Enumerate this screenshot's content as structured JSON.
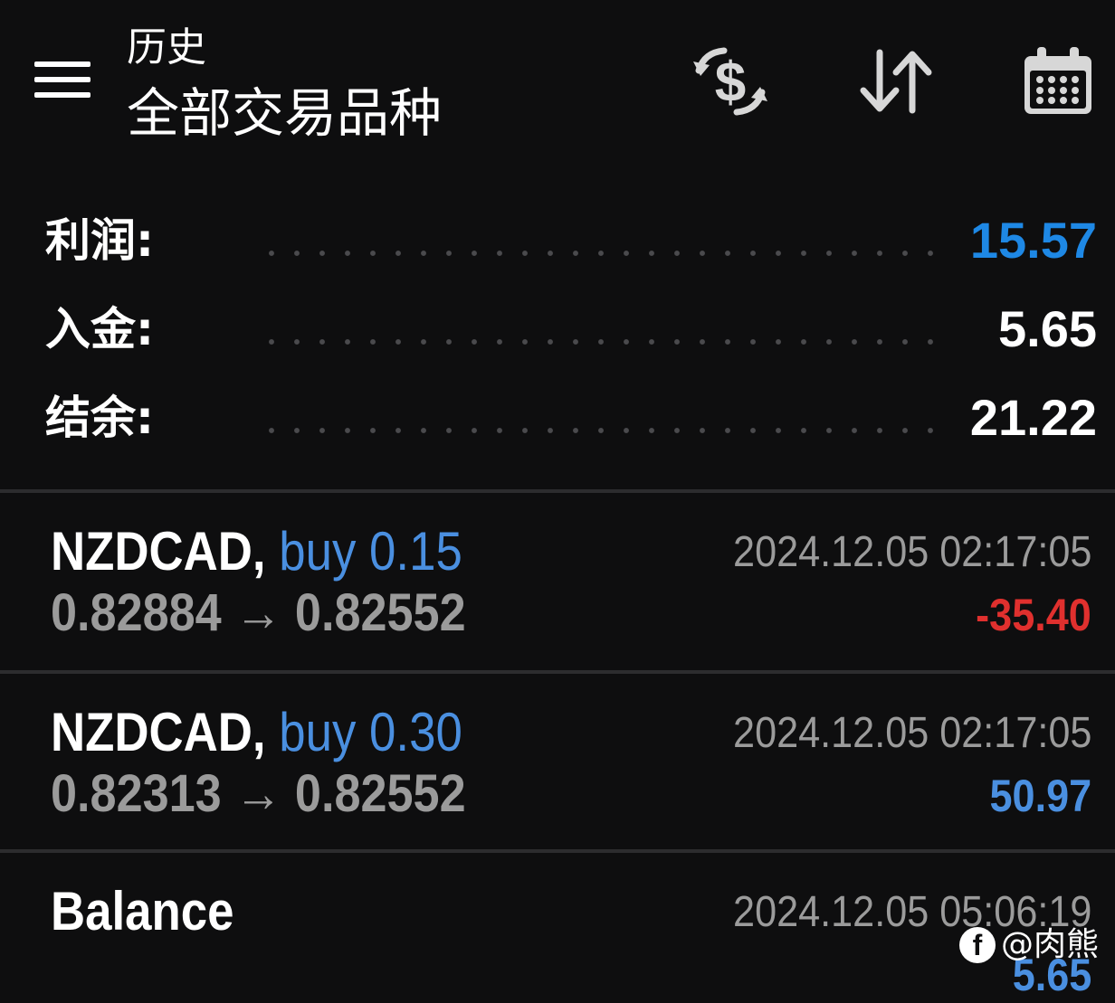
{
  "header": {
    "subtitle": "历史",
    "title": "全部交易品种",
    "icons": [
      "menu-icon",
      "currency-exchange-icon",
      "sort-icon",
      "calendar-icon"
    ]
  },
  "summary": [
    {
      "label": "利润:",
      "value": "15.57",
      "color": "#1e88e5"
    },
    {
      "label": "入金:",
      "value": "5.65",
      "color": "#ffffff"
    },
    {
      "label": "结余:",
      "value": "21.22",
      "color": "#ffffff"
    }
  ],
  "deals": [
    {
      "symbol": "NZDCAD,",
      "type": "buy 0.15",
      "open_price": "0.82884",
      "arrow": "→",
      "close_price": "0.82552",
      "time": "2024.12.05 02:17:05",
      "profit": "-35.40",
      "profit_color": "#e0302e"
    },
    {
      "symbol": "NZDCAD,",
      "type": "buy 0.30",
      "open_price": "0.82313",
      "arrow": "→",
      "close_price": "0.82552",
      "time": "2024.12.05 02:17:05",
      "profit": "50.97",
      "profit_color": "#4a8fe0"
    },
    {
      "symbol": "Balance",
      "time": "2024.12.05 05:06:19",
      "profit": "5.65",
      "profit_color": "#4a8fe0"
    }
  ],
  "watermark": {
    "logo": "f",
    "text": "@肉熊"
  },
  "colors": {
    "background": "#0e0e0f",
    "accent_blue": "#1e88e5",
    "loss_red": "#e0302e",
    "muted_gray": "#9b9b9b"
  }
}
